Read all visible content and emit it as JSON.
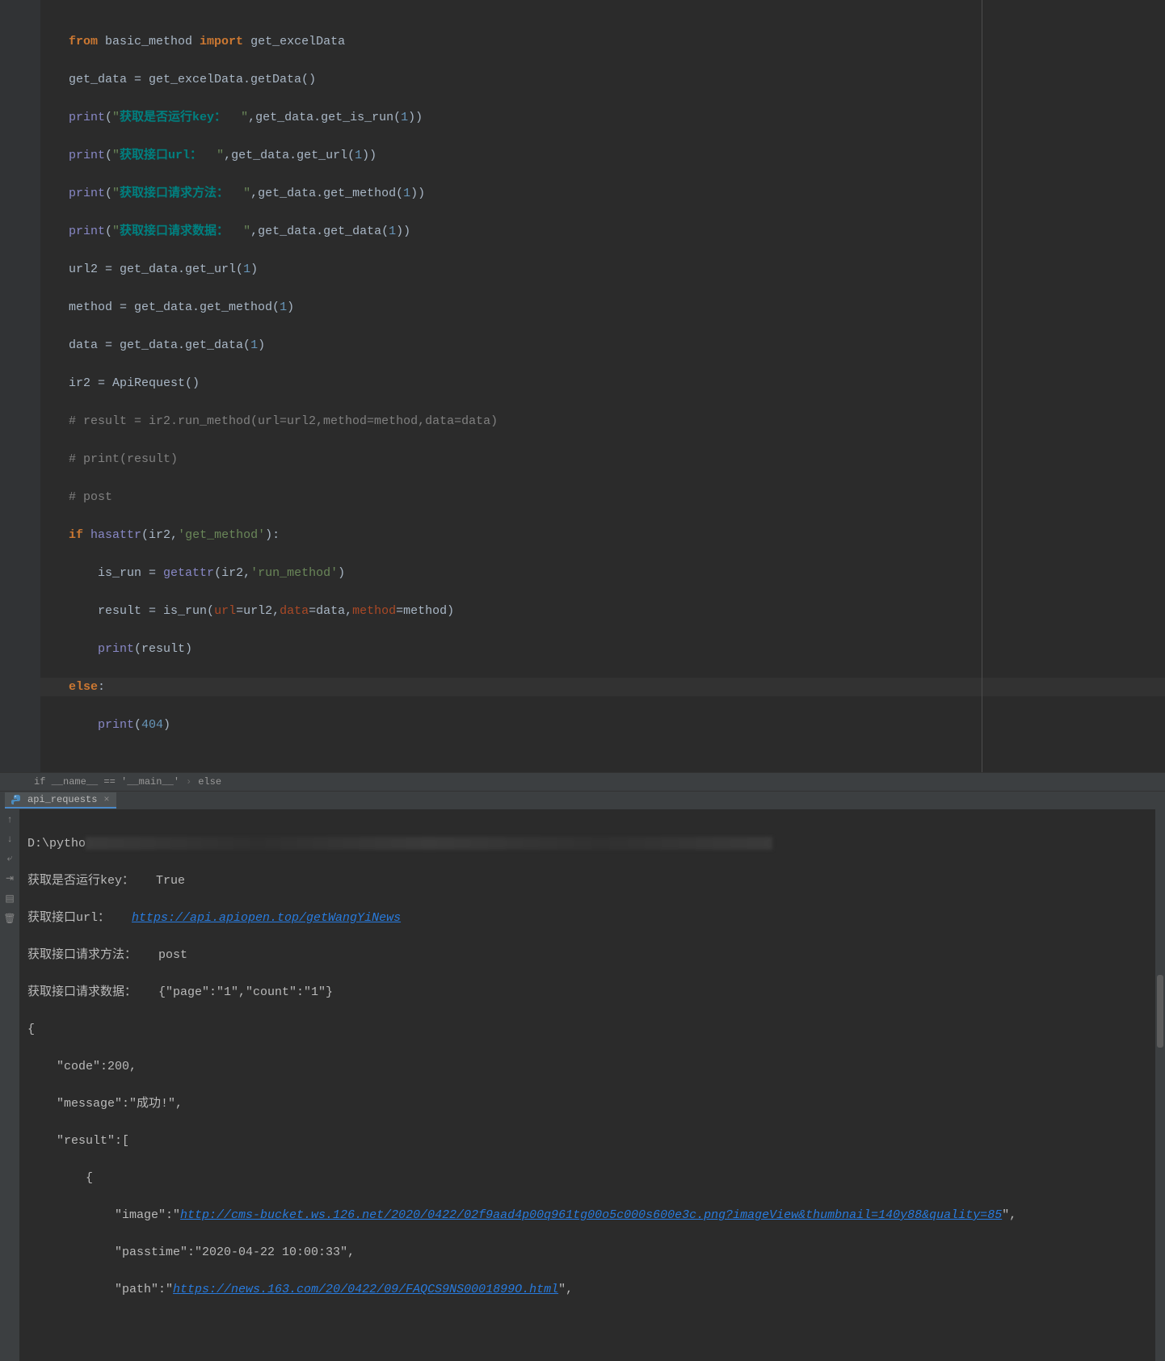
{
  "breadcrumb": {
    "item1": "if __name__ == '__main__'",
    "item2": "else"
  },
  "tab": {
    "label": "api_requests"
  },
  "code": {
    "l1_from": "from ",
    "l1_mod": "basic_method ",
    "l1_import": "import ",
    "l1_name": "get_excelData",
    "l2_a": "get_data ",
    "l2_eq": "= ",
    "l2_b": "get_excelData.getData()",
    "l3_print": "print",
    "l3_open": "(",
    "l3_q": "\"",
    "l3_str": "获取是否运行key：  ",
    "l3_comma": ",",
    "l3_call": "get_data.get_is_run(",
    "l3_num": "1",
    "l3_close": "))",
    "l4_str": "获取接口url：  ",
    "l4_call": "get_data.get_url(",
    "l5_str": "获取接口请求方法：  ",
    "l5_call": "get_data.get_method(",
    "l6_str": "获取接口请求数据：  ",
    "l6_call": "get_data.get_data(",
    "l7": "url2 ",
    "l7_eq": "= ",
    "l7_call": "get_data.get_url(",
    "l7_num": "1",
    "l7_close": ")",
    "l8": "method ",
    "l8_call": "get_data.get_method(",
    "l9": "data ",
    "l9_call": "get_data.get_data(",
    "l10": "ir2 ",
    "l10_call": "ApiRequest()",
    "l11": "# result = ir2.run_method(url=url2,method=method,data=data)",
    "l12": "# print(result)",
    "l13": "# post",
    "l14_if": "if ",
    "l14_hasattr": "hasattr",
    "l14_open": "(ir2",
    "l14_comma": ",",
    "l14_str": "'get_method'",
    "l14_close": "):",
    "l15_a": "    is_run ",
    "l15_getattr": "getattr",
    "l15_open": "(ir2",
    "l15_str": "'run_method'",
    "l15_close": ")",
    "l16_a": "    result ",
    "l16_call": "is_run(",
    "l16_p1": "url",
    "l16_v1": "=url2",
    "l16_p2": "data",
    "l16_v2": "=data",
    "l16_p3": "method",
    "l16_v3": "=method)",
    "l17_print": "    print",
    "l17_arg": "(result)",
    "l18_else": "else",
    "l18_colon": ":",
    "l19_print": "    print",
    "l19_open": "(",
    "l19_num": "404",
    "l19_close": ")"
  },
  "console": {
    "l1_prefix": "D:\\pytho",
    "l2": "获取是否运行key：   True",
    "l3_a": "获取接口url：   ",
    "l3_link": "https://api.apiopen.top/getWangYiNews",
    "l4": "获取接口请求方法：   post",
    "l5": "获取接口请求数据：   {\"page\":\"1\",\"count\":\"1\"}",
    "l6": "{",
    "l7": "    \"code\":200,",
    "l8": "    \"message\":\"成功!\",",
    "l9": "    \"result\":[",
    "l10": "        {",
    "l11_a": "            \"image\":\"",
    "l11_link": "http://cms-bucket.ws.126.net/2020/0422/02f9aad4p00q961tg00o5c000s600e3c.png?imageView&thumbnail=140y88&quality=85",
    "l11_b": "\",",
    "l12": "            \"passtime\":\"2020-04-22 10:00:33\",",
    "l13_a": "            \"path\":\"",
    "l13_link": "https://news.163.com/20/0422/09/FAQCS9NS0001899O.html",
    "l13_b": "\","
  }
}
